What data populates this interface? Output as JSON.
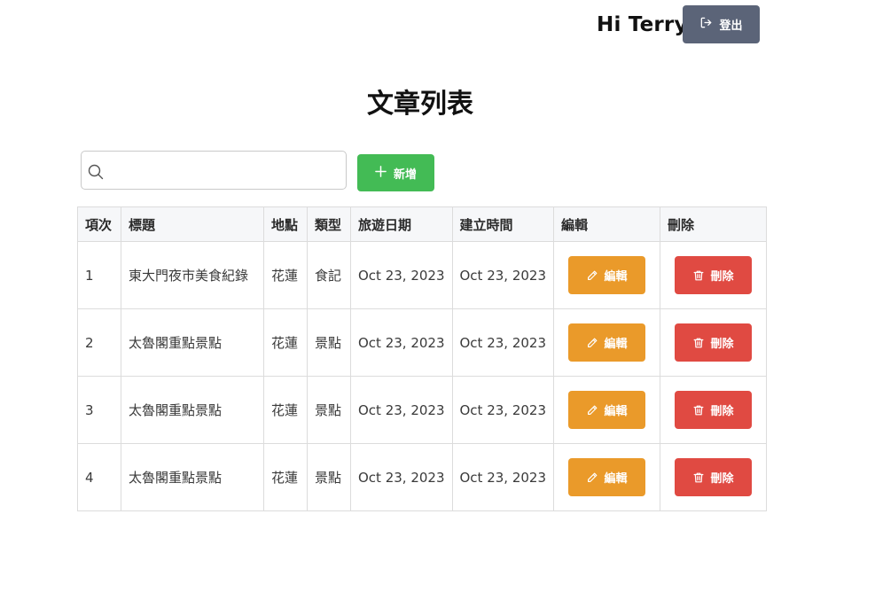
{
  "header": {
    "greeting": "Hi Terry",
    "logout_label": "登出",
    "logout_icon": "logout-icon"
  },
  "main": {
    "title": "文章列表",
    "search": {
      "value": "",
      "placeholder": "",
      "icon": "search-icon"
    },
    "add_label": "新增",
    "add_icon": "plus-icon"
  },
  "table": {
    "headers": {
      "index": "項次",
      "title": "標題",
      "location": "地點",
      "type": "類型",
      "travel_date": "旅遊日期",
      "created_at": "建立時間",
      "edit": "編輯",
      "delete": "刪除"
    },
    "rows": [
      {
        "index": "1",
        "title": "東大門夜市美食紀錄",
        "location": "花蓮",
        "type": "食記",
        "travel_date": "Oct 23, 2023",
        "created_at": "Oct 23, 2023",
        "edit_label": "編輯",
        "delete_label": "刪除"
      },
      {
        "index": "2",
        "title": "太魯閣重點景點",
        "location": "花蓮",
        "type": "景點",
        "travel_date": "Oct 23, 2023",
        "created_at": "Oct 23, 2023",
        "edit_label": "編輯",
        "delete_label": "刪除"
      },
      {
        "index": "3",
        "title": "太魯閣重點景點",
        "location": "花蓮",
        "type": "景點",
        "travel_date": "Oct 23, 2023",
        "created_at": "Oct 23, 2023",
        "edit_label": "編輯",
        "delete_label": "刪除"
      },
      {
        "index": "4",
        "title": "太魯閣重點景點",
        "location": "花蓮",
        "type": "景點",
        "travel_date": "Oct 23, 2023",
        "created_at": "Oct 23, 2023",
        "edit_label": "編輯",
        "delete_label": "刪除"
      }
    ]
  },
  "colors": {
    "logout_button": "#5b6478",
    "add_button": "#43bb55",
    "edit_button": "#ea9a2a",
    "delete_button": "#e04a42",
    "table_header_bg": "#f6f7f9",
    "table_border": "#dcdcdc"
  }
}
